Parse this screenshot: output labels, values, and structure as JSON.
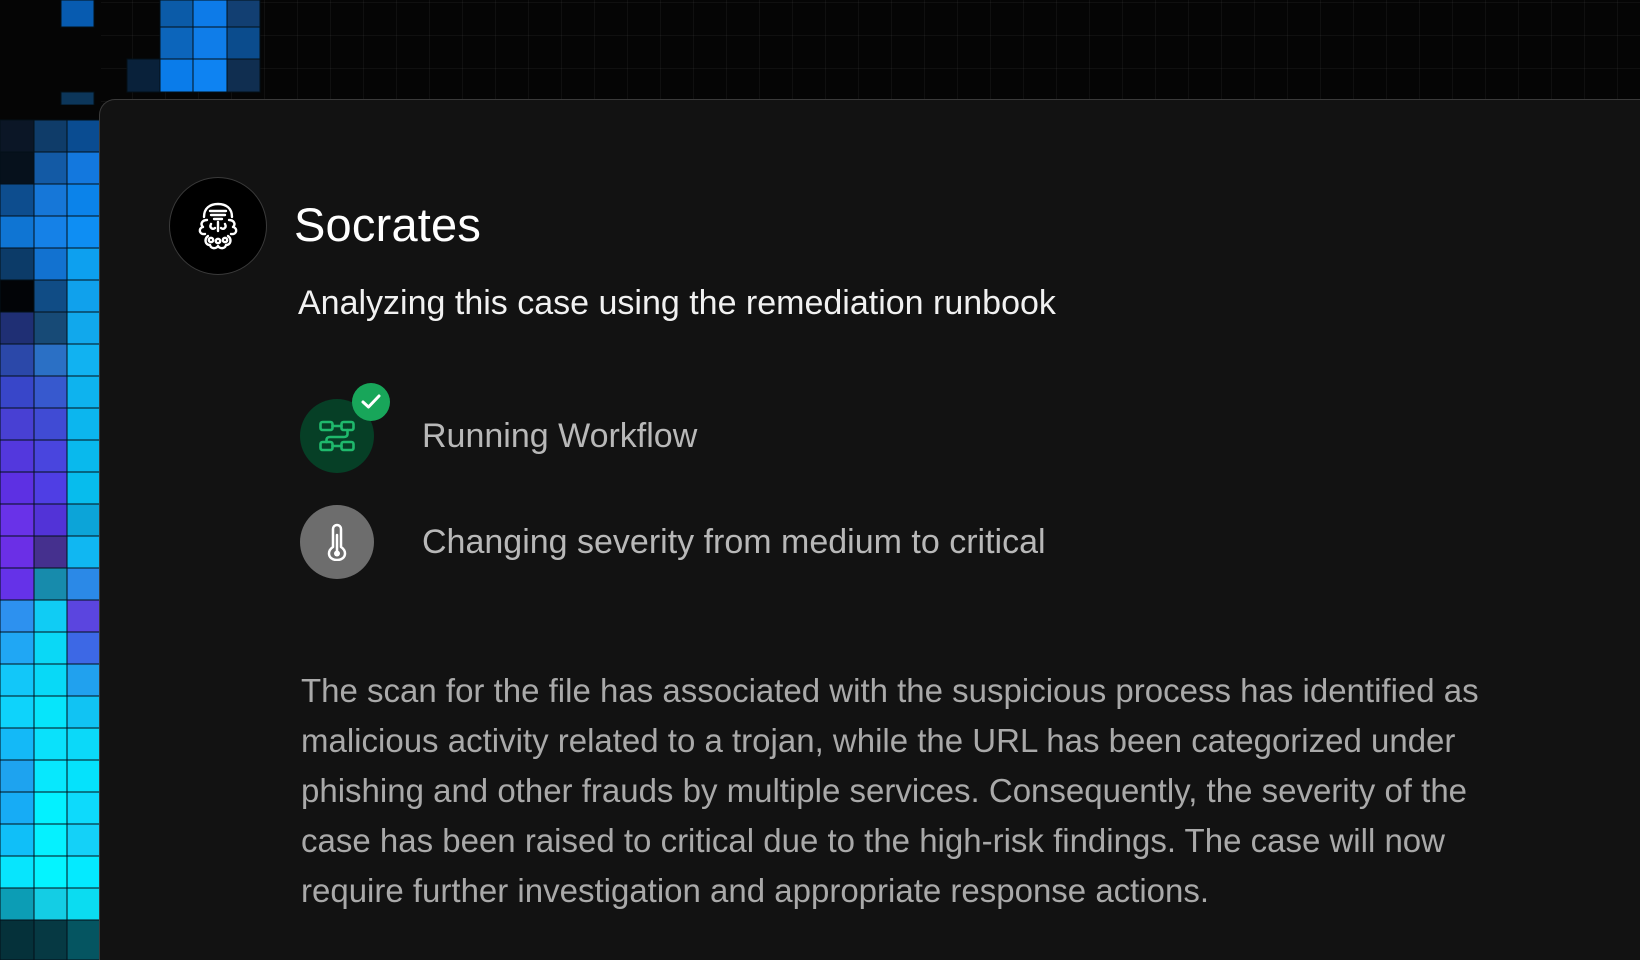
{
  "agent": {
    "name": "Socrates",
    "avatar_icon": "philosopher-bust-icon",
    "status": "Analyzing this case using the remediation runbook"
  },
  "steps": [
    {
      "label": "Running Workflow",
      "icon": "workflow-icon",
      "completed": true,
      "badge_icon": "check-icon",
      "accent": "#18a65a"
    },
    {
      "label": "Changing severity from medium to critical",
      "icon": "thermometer-icon",
      "completed": false
    }
  ],
  "summary": "The scan for the file has associated with the suspicious process has identified as malicious activity related to a trojan, while the URL has been categorized under phishing and other frauds by multiple services. Consequently, the severity of the case has been raised to critical due to the high-risk findings. The case will now require further investigation and appropriate response actions.",
  "colors": {
    "background": "#050505",
    "panel": "#121212",
    "success_green": "#18a65a",
    "workflow_icon_background": "#063f26",
    "severity_icon_background": "#6d6d6d"
  }
}
